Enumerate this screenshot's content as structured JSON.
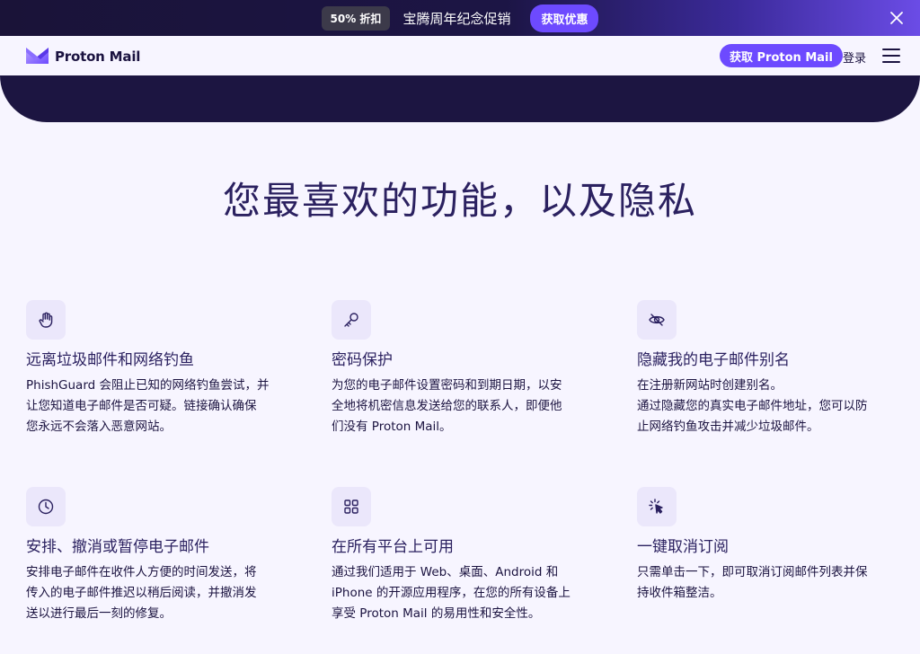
{
  "promo": {
    "badge": "50% 折扣",
    "text": "宝腾周年纪念促销",
    "cta": "获取优惠",
    "close_icon": "close-icon"
  },
  "header": {
    "logo_text": "Proton Mail",
    "get_button": "获取 Proton Mail",
    "login": "登录",
    "menu_icon": "hamburger-menu-icon"
  },
  "colors": {
    "brand": "#6d4aff",
    "dark": "#1c1541",
    "background": "#f7f5ff"
  },
  "section": {
    "title": "您最喜欢的功能，以及隐私"
  },
  "features": [
    {
      "icon": "hand-stop-icon",
      "title": "远离垃圾邮件和网络钓鱼",
      "lines": [
        "PhishGuard 会阻止已知的网络钓鱼尝试，并",
        "让您知道电子邮件是否可疑。链接确认确保",
        "您永远不会落入恶意网站。"
      ]
    },
    {
      "icon": "key-icon",
      "title": "密码保护",
      "lines": [
        "为您的电子邮件设置密码和到期日期，以安",
        "全地将机密信息发送给您的联系人，即便他",
        "们没有 Proton Mail。"
      ]
    },
    {
      "icon": "eye-slash-icon",
      "title": "隐藏我的电子邮件别名",
      "lines": [
        "在注册新网站时创建别名。",
        "通过隐藏您的真实电子邮件地址，您可以防",
        "止网络钓鱼攻击并减少垃圾邮件。"
      ]
    },
    {
      "icon": "clock-icon",
      "title": "安排、撤消或暂停电子邮件",
      "lines": [
        "安排电子邮件在收件人方便的时间发送，将",
        "传入的电子邮件推迟以稍后阅读，并撤消发",
        "送以进行最后一刻的修复。"
      ]
    },
    {
      "icon": "grid-apps-icon",
      "title": "在所有平台上可用",
      "lines": [
        "通过我们适用于 Web、桌面、Android 和",
        "iPhone 的开源应用程序，在您的所有设备上",
        "享受 Proton Mail 的易用性和安全性。"
      ]
    },
    {
      "icon": "cursor-click-icon",
      "title": "一键取消订阅",
      "lines": [
        "只需单击一下，即可取消订阅邮件列表并保",
        "持收件箱整洁。"
      ]
    }
  ]
}
